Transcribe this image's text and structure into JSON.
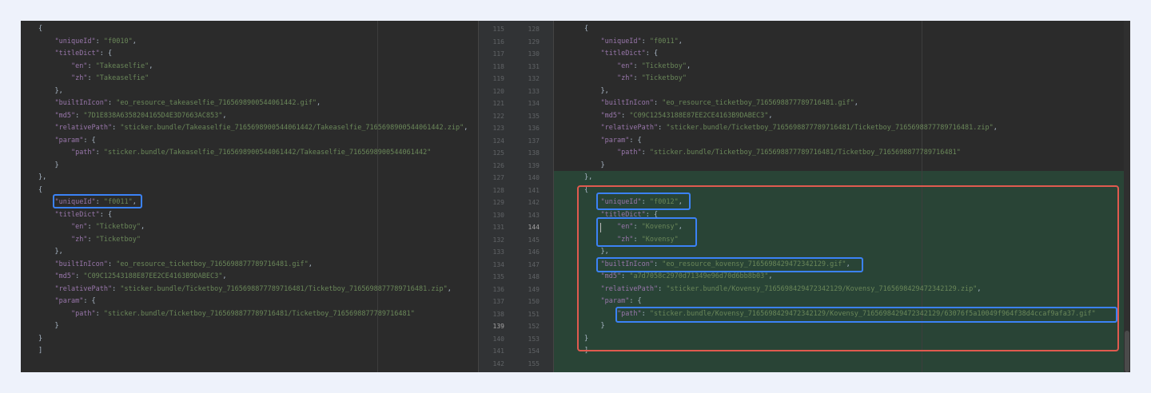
{
  "left_lines": [
    "{",
    "    \"uniqueId\": \"f0010\",",
    "    \"titleDict\": {",
    "        \"en\": \"Takeaselfie\",",
    "        \"zh\": \"Takeaselfie\"",
    "    },",
    "    \"builtInIcon\": \"eo_resource_takeaselfie_7165698900544061442.gif\",",
    "    \"md5\": \"7D1E838A6358204165D4E3D7663AC853\",",
    "    \"relativePath\": \"sticker.bundle/Takeaselfie_7165698900544061442/Takeaselfie_7165698900544061442.zip\",",
    "    \"param\": {",
    "        \"path\": \"sticker.bundle/Takeaselfie_7165698900544061442/Takeaselfie_7165698900544061442\"",
    "    }",
    "},",
    "{",
    "    \"uniqueId\": \"f0011\",",
    "    \"titleDict\": {",
    "        \"en\": \"Ticketboy\",",
    "        \"zh\": \"Ticketboy\"",
    "    },",
    "    \"builtInIcon\": \"eo_resource_ticketboy_7165698877789716481.gif\",",
    "    \"md5\": \"C09C12543188E87EE2CE4163B9DABEC3\",",
    "    \"relativePath\": \"sticker.bundle/Ticketboy_7165698877789716481/Ticketboy_7165698877789716481.zip\",",
    "    \"param\": {",
    "        \"path\": \"sticker.bundle/Ticketboy_7165698877789716481/Ticketboy_7165698877789716481\"",
    "    }",
    "}",
    "]"
  ],
  "right_lines": [
    "{",
    "    \"uniqueId\": \"f0011\",",
    "    \"titleDict\": {",
    "        \"en\": \"Ticketboy\",",
    "        \"zh\": \"Ticketboy\"",
    "    },",
    "    \"builtInIcon\": \"eo_resource_ticketboy_7165698877789716481.gif\",",
    "    \"md5\": \"C09C12543188E87EE2CE4163B9DABEC3\",",
    "    \"relativePath\": \"sticker.bundle/Ticketboy_7165698877789716481/Ticketboy_7165698877789716481.zip\",",
    "    \"param\": {",
    "        \"path\": \"sticker.bundle/Ticketboy_7165698877789716481/Ticketboy_7165698877789716481\"",
    "    }",
    "},",
    "{",
    "    \"uniqueId\": \"f0012\",",
    "    \"titleDict\": {",
    "        \"en\": \"Kovensy\",",
    "        \"zh\": \"Kovensy\"",
    "    },",
    "    \"builtInIcon\": \"eo_resource_kovensy_7165698429472342129.gif\",",
    "    \"md5\": \"a7d7058c2970d71349e96d70d6bb8b03\",",
    "    \"relativePath\": \"sticker.bundle/Kovensy_7165698429472342129/Kovensy_7165698429472342129.zip\",",
    "    \"param\": {",
    "        \"path\": \"sticker.bundle/Kovensy_7165698429472342129/Kovensy_7165698429472342129/63076f5a10049f964f38d4ccaf9afa37.gif\"",
    "    }",
    "}",
    "]"
  ],
  "gutter_left_numbers": [
    "115",
    "116",
    "117",
    "118",
    "119",
    "120",
    "121",
    "122",
    "123",
    "124",
    "125",
    "126",
    "127",
    "128",
    "129",
    "130",
    "131",
    "132",
    "133",
    "134",
    "135",
    "136",
    "137",
    "138",
    "139",
    "140",
    "141",
    "142"
  ],
  "gutter_right_numbers": [
    "128",
    "129",
    "130",
    "131",
    "132",
    "133",
    "134",
    "135",
    "136",
    "137",
    "138",
    "139",
    "140",
    "141",
    "142",
    "143",
    "144",
    "145",
    "146",
    "147",
    "148",
    "149",
    "150",
    "151",
    "152",
    "153",
    "154",
    "155"
  ],
  "current_line_left": "139",
  "current_line_right": "144",
  "colors": {
    "added_bg": "#294436",
    "highlight_blue": "#3b82f6",
    "highlight_red": "#e05a4f"
  }
}
